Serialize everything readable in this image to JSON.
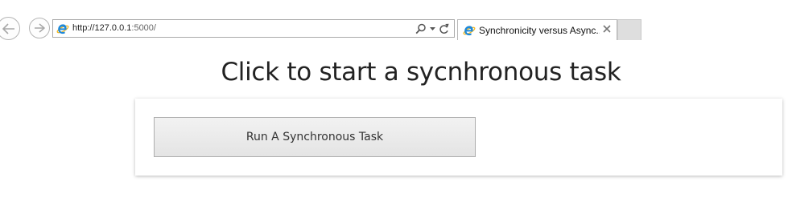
{
  "browser": {
    "url": {
      "host": "http://127.0.0.1",
      "rest": ":5000/"
    },
    "tab": {
      "title": "Synchronicity versus Async..."
    },
    "icons": {
      "back": "back-arrow-icon",
      "forward": "forward-arrow-icon",
      "browser_logo": "ie-logo-icon",
      "search": "search-icon",
      "dropdown": "chevron-down-icon",
      "refresh": "refresh-icon",
      "close_tab": "close-icon"
    },
    "colors": {
      "ie_blue": "#1e88d8",
      "ie_gold": "#f3b71c"
    }
  },
  "page": {
    "heading": "Click to start a sycnhronous task",
    "run_button_label": "Run A Synchronous Task"
  }
}
